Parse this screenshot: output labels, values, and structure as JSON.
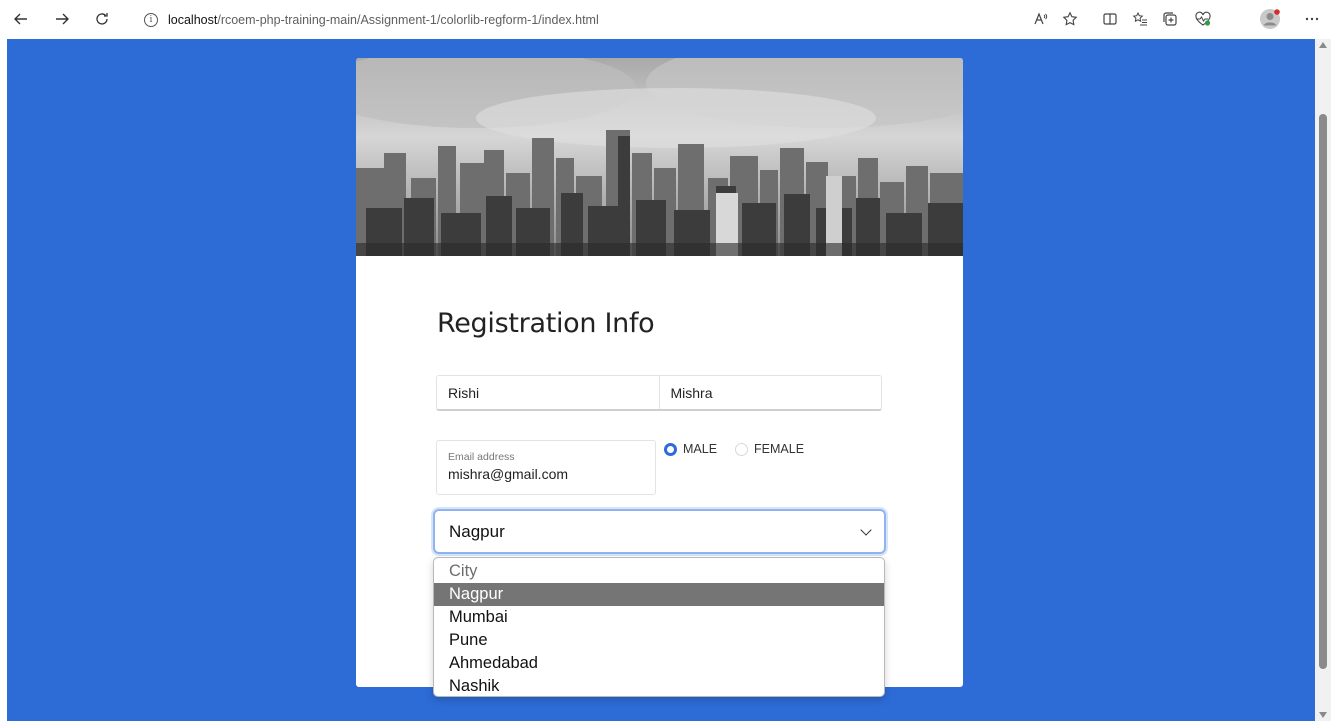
{
  "browser": {
    "url_host": "localhost",
    "url_path": "/rcoem-php-training-main/Assignment-1/colorlib-regform-1/index.html",
    "read_aloud_label": "A͡"
  },
  "form": {
    "title": "Registration Info",
    "first_name": "Rishi",
    "last_name": "Mishra",
    "email_label": "Email address",
    "email_value": "mishra@gmail.com",
    "gender_options": [
      {
        "label": "MALE",
        "checked": true
      },
      {
        "label": "FEMALE",
        "checked": false
      }
    ],
    "city_selected": "Nagpur",
    "city_options": [
      "City",
      "Nagpur",
      "Mumbai",
      "Pune",
      "Ahmedabad",
      "Nashik"
    ]
  },
  "colors": {
    "page_background": "#2d6bd6",
    "radio_checked": "#2d6bd6",
    "dropdown_highlight": "#757575"
  },
  "icons": {
    "back": "arrow-left-icon",
    "forward": "arrow-right-icon",
    "refresh": "refresh-icon",
    "site_info": "info-icon",
    "read_aloud": "read-aloud-icon",
    "favorite": "star-icon",
    "split_screen": "split-screen-icon",
    "favorites_list": "favorites-list-icon",
    "collections": "collections-icon",
    "browser_essentials": "heart-pulse-icon",
    "profile": "avatar",
    "more": "more-icon"
  }
}
